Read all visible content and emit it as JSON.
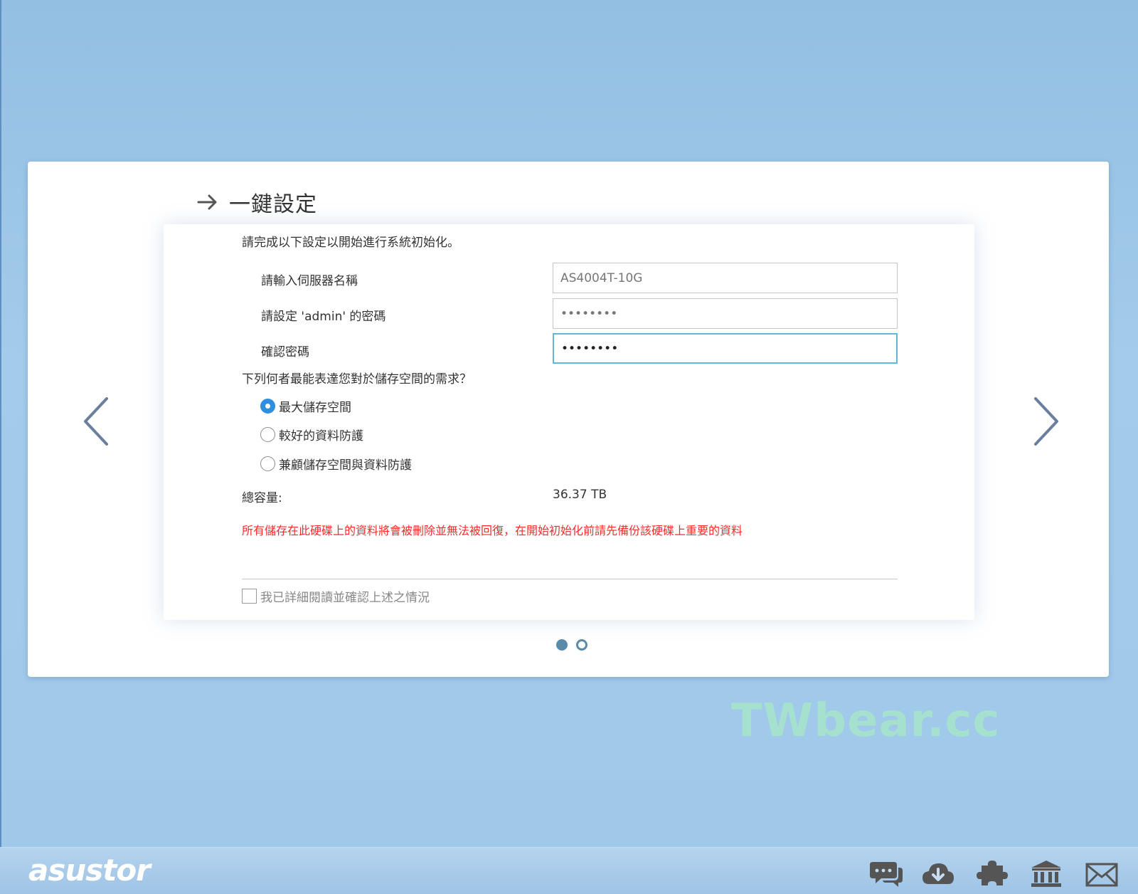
{
  "wizard": {
    "title": "一鍵設定",
    "intro": "請完成以下設定以開始進行系統初始化。",
    "fields": [
      {
        "label": "請輸入伺服器名稱",
        "value": "AS4004T-10G"
      },
      {
        "label": "請設定 'admin' 的密碼",
        "value": "••••••••"
      },
      {
        "label": "確認密碼",
        "value": "••••••••"
      }
    ],
    "question": "下列何者最能表達您對於儲存空間的需求？",
    "options": [
      {
        "label": "最大儲存空間",
        "checked": true
      },
      {
        "label": "較好的資料防護",
        "checked": false
      },
      {
        "label": "兼顧儲存空間與資料防護",
        "checked": false
      }
    ],
    "capacity_label": "總容量:",
    "capacity_value": "36.37 TB",
    "warning": "所有儲存在此硬碟上的資料將會被刪除並無法被回復，在開始初始化前請先備份該硬碟上重要的資料",
    "confirm_label": "我已詳細閱讀並確認上述之情況",
    "pagination": {
      "current": 1,
      "total": 2
    }
  },
  "watermark": "TWbear.cc",
  "footer": {
    "logo": "asustor",
    "icons": [
      "chat-icon",
      "cloud-download-icon",
      "puzzle-icon",
      "bank-icon",
      "mail-icon"
    ]
  },
  "colors": {
    "accent": "#2e8ee0",
    "focus_border": "#5eb8d8",
    "warning": "#ff2a2a",
    "dot": "#5b8baa"
  }
}
